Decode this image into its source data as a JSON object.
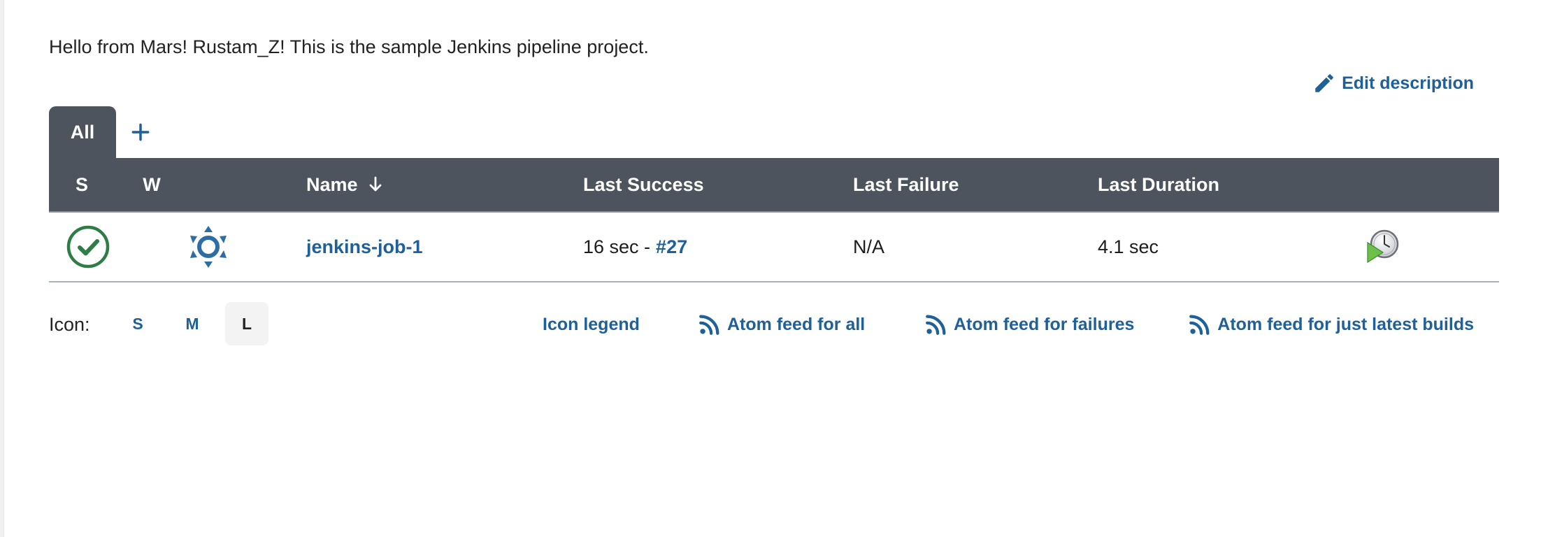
{
  "description": "Hello from Mars! Rustam_Z! This is the sample Jenkins pipeline project.",
  "edit_description": {
    "label": "Edit description",
    "icon": "pencil-icon"
  },
  "tabs": {
    "items": [
      {
        "label": "All",
        "active": true
      }
    ],
    "add_icon": "plus-icon"
  },
  "table": {
    "columns": {
      "status": "S",
      "weather": "W",
      "name": "Name",
      "name_sort_icon": "arrow-down-icon",
      "last_success": "Last Success",
      "last_failure": "Last Failure",
      "last_duration": "Last Duration"
    },
    "rows": [
      {
        "status_icon": "success-check-icon",
        "weather_icon": "sunny-weather-icon",
        "name": "jenkins-job-1",
        "last_success_time": "16 sec -",
        "last_success_build": "#27",
        "last_failure": "N/A",
        "last_duration": "4.1 sec",
        "action_icon": "schedule-build-icon"
      }
    ]
  },
  "footer": {
    "icon_label": "Icon:",
    "sizes": [
      "S",
      "M",
      "L"
    ],
    "selected_size": "L",
    "icon_legend": "Icon legend",
    "feed_all": "Atom feed for all",
    "feed_failures": "Atom feed for failures",
    "feed_latest": "Atom feed for just latest builds",
    "feed_icon": "rss-icon"
  },
  "colors": {
    "link": "#1f6098",
    "header_bg": "#4d545d",
    "success": "#2e7d46",
    "weather": "#2e6da4"
  }
}
